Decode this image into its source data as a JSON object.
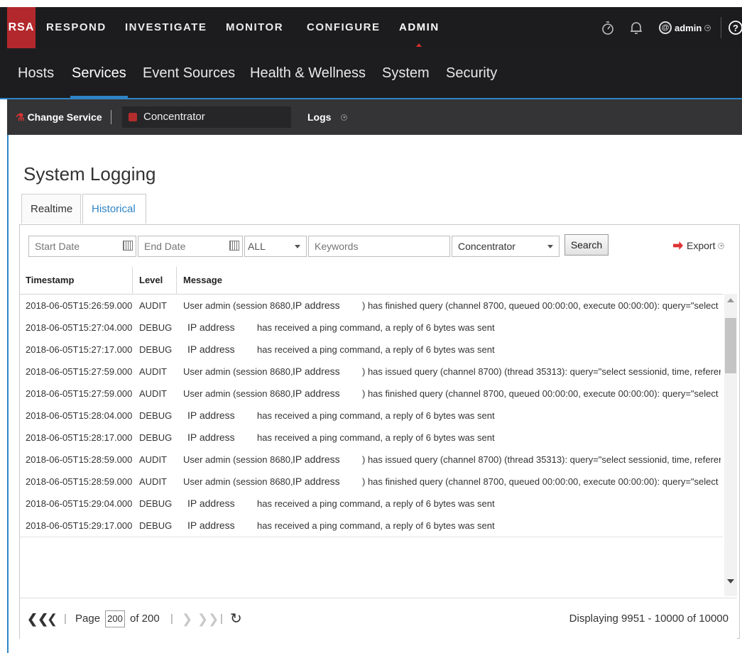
{
  "app": {
    "logo": "RSA"
  },
  "topnav": {
    "items": [
      "RESPOND",
      "INVESTIGATE",
      "MONITOR",
      "CONFIGURE",
      "ADMIN"
    ],
    "active": "ADMIN",
    "user": "admin",
    "icons": [
      "stopwatch-icon",
      "bell-icon",
      "user-icon",
      "help-icon"
    ]
  },
  "subnav": {
    "items": [
      "Hosts",
      "Services",
      "Event Sources",
      "Health & Wellness",
      "System",
      "Security"
    ],
    "active": "Services"
  },
  "servicebar": {
    "change_service": "Change Service",
    "service_name": "Concentrator",
    "view": "Logs"
  },
  "page": {
    "title": "System Logging",
    "tabs": [
      "Realtime",
      "Historical"
    ],
    "active_tab": "Historical"
  },
  "filters": {
    "start_date_placeholder": "Start Date",
    "end_date_placeholder": "End Date",
    "level_value": "ALL",
    "keywords_placeholder": "Keywords",
    "service_value": "Concentrator",
    "search_label": "Search",
    "export_label": "Export"
  },
  "table": {
    "columns": [
      "Timestamp",
      "Level",
      "Message"
    ],
    "rows": [
      {
        "ts": "2018-06-05T15:26:59.000",
        "level": "AUDIT",
        "pre": "User admin (session 8680,",
        "ip": "IP address",
        "msg": ") has finished query (channel 8700, queued 00:00:00, execute 00:00:00): query=\"select s..."
      },
      {
        "ts": "2018-06-05T15:27:04.000",
        "level": "DEBUG",
        "pre": "",
        "ip": "IP address",
        "msg": "has received a ping command, a reply of 6 bytes was sent"
      },
      {
        "ts": "2018-06-05T15:27:17.000",
        "level": "DEBUG",
        "pre": "",
        "ip": "IP address",
        "msg": "has received a ping command, a reply of 6 bytes was sent"
      },
      {
        "ts": "2018-06-05T15:27:59.000",
        "level": "AUDIT",
        "pre": "User admin (session 8680,",
        "ip": "IP address",
        "msg": ") has issued query (channel 8700) (thread 35313): query=\"select sessionid, time, referer,..."
      },
      {
        "ts": "2018-06-05T15:27:59.000",
        "level": "AUDIT",
        "pre": "User admin (session 8680,",
        "ip": "IP address",
        "msg": ") has finished query (channel 8700, queued 00:00:00, execute 00:00:00): query=\"select s..."
      },
      {
        "ts": "2018-06-05T15:28:04.000",
        "level": "DEBUG",
        "pre": "",
        "ip": "IP address",
        "msg": "has received a ping command, a reply of 6 bytes was sent"
      },
      {
        "ts": "2018-06-05T15:28:17.000",
        "level": "DEBUG",
        "pre": "",
        "ip": "IP address",
        "msg": "has received a ping command, a reply of 6 bytes was sent"
      },
      {
        "ts": "2018-06-05T15:28:59.000",
        "level": "AUDIT",
        "pre": "User admin (session 8680,",
        "ip": "IP address",
        "msg": ") has issued query (channel 8700) (thread 35313): query=\"select sessionid, time, referer,..."
      },
      {
        "ts": "2018-06-05T15:28:59.000",
        "level": "AUDIT",
        "pre": "User admin (session 8680,",
        "ip": "IP address",
        "msg": ") has finished query (channel 8700, queued 00:00:00, execute 00:00:00): query=\"select s..."
      },
      {
        "ts": "2018-06-05T15:29:04.000",
        "level": "DEBUG",
        "pre": "",
        "ip": "IP address",
        "msg": "has received a ping command, a reply of 6 bytes was sent"
      },
      {
        "ts": "2018-06-05T15:29:17.000",
        "level": "DEBUG",
        "pre": "",
        "ip": "IP address",
        "msg": "has received a ping command, a reply of 6 bytes was sent"
      }
    ]
  },
  "pager": {
    "page_label": "Page",
    "page_value": "200",
    "of_label": "of 200",
    "display": "Displaying 9951 - 10000 of 10000"
  },
  "colors": {
    "brand_red": "#b3282c",
    "accent_blue": "#2f84c6",
    "nav_bg": "#1c1c1e"
  }
}
